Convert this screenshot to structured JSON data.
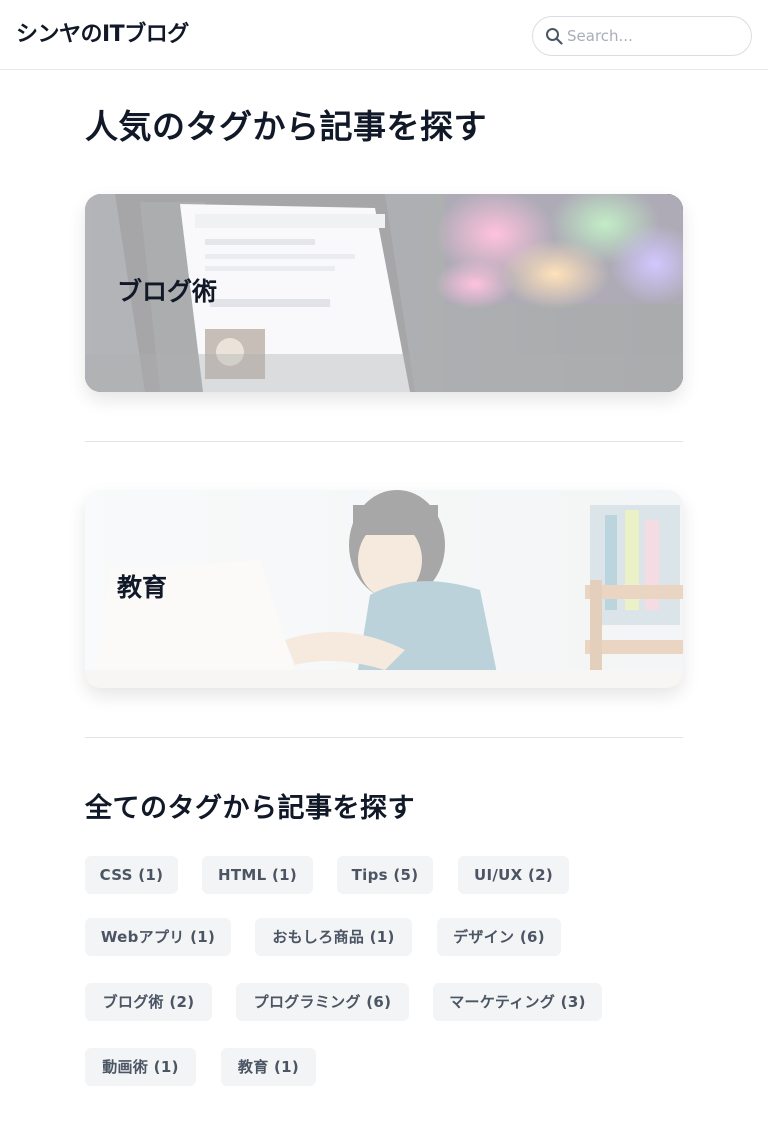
{
  "header": {
    "site_title": "シンヤのITブログ",
    "search_placeholder": "Search...",
    "search_icon": "search-icon"
  },
  "popular": {
    "title": "人気のタグから記事を探す",
    "cards": [
      {
        "label": "ブログ術"
      },
      {
        "label": "教育"
      }
    ]
  },
  "all_tags": {
    "title": "全てのタグから記事を探す",
    "tags": [
      "CSS (1)",
      "HTML (1)",
      "Tips (5)",
      "UI/UX (2)",
      "Webアプリ (1)",
      "おもしろ商品 (1)",
      "デザイン (6)",
      "ブログ術 (2)",
      "プログラミング (6)",
      "マーケティング (3)",
      "動画術 (1)",
      "教育 (1)"
    ]
  },
  "colors": {
    "text_primary": "#111827",
    "chip_bg": "#f3f4f6",
    "chip_text": "#4b5563",
    "divider": "#e3e4e8"
  }
}
